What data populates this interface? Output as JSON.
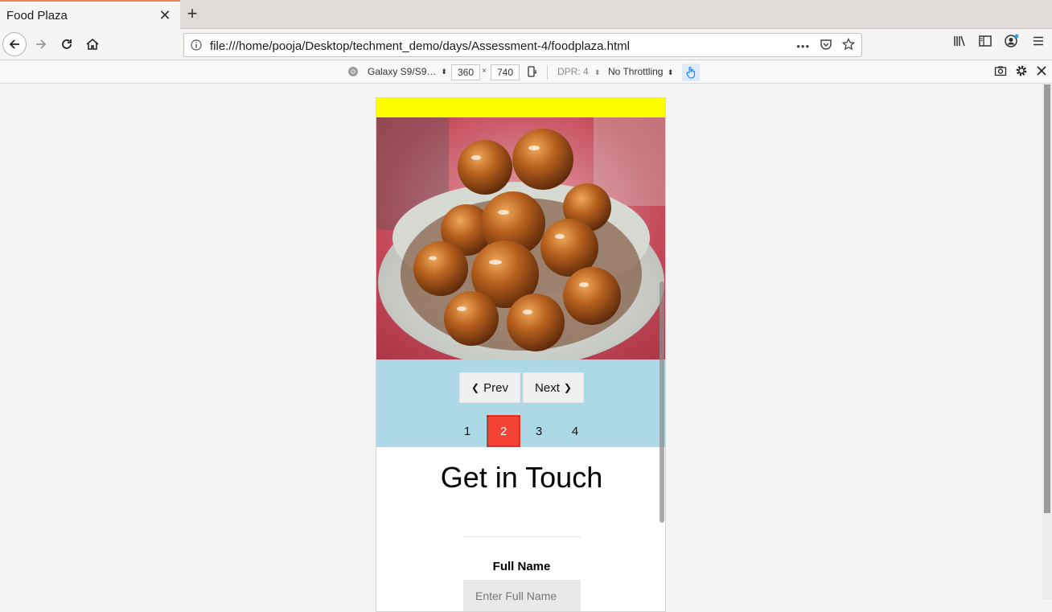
{
  "browser": {
    "tab_title": "Food Plaza",
    "tab_close": "✕",
    "new_tab": "+",
    "url": "file:///home/pooja/Desktop/techment_demo/days/Assessment-4/foodplaza.html",
    "url_more": "•••"
  },
  "rdm": {
    "device_name": "Galaxy S9/S9…",
    "width": "360",
    "height": "740",
    "x_separator": "×",
    "dpr": "DPR: 4",
    "throttling": "No Throttling"
  },
  "page": {
    "slider": {
      "prev_label": "Prev",
      "next_label": "Next",
      "prev_chevron": "❮",
      "next_chevron": "❯",
      "dots": [
        "1",
        "2",
        "3",
        "4"
      ],
      "active_dot": 2
    },
    "contact": {
      "heading": "Get in Touch",
      "full_name_label": "Full Name",
      "full_name_placeholder": "Enter Full Name"
    }
  },
  "colors": {
    "header_bar": "#ffff00",
    "slider_bg": "#add8e6",
    "active_dot": "#f44336"
  }
}
